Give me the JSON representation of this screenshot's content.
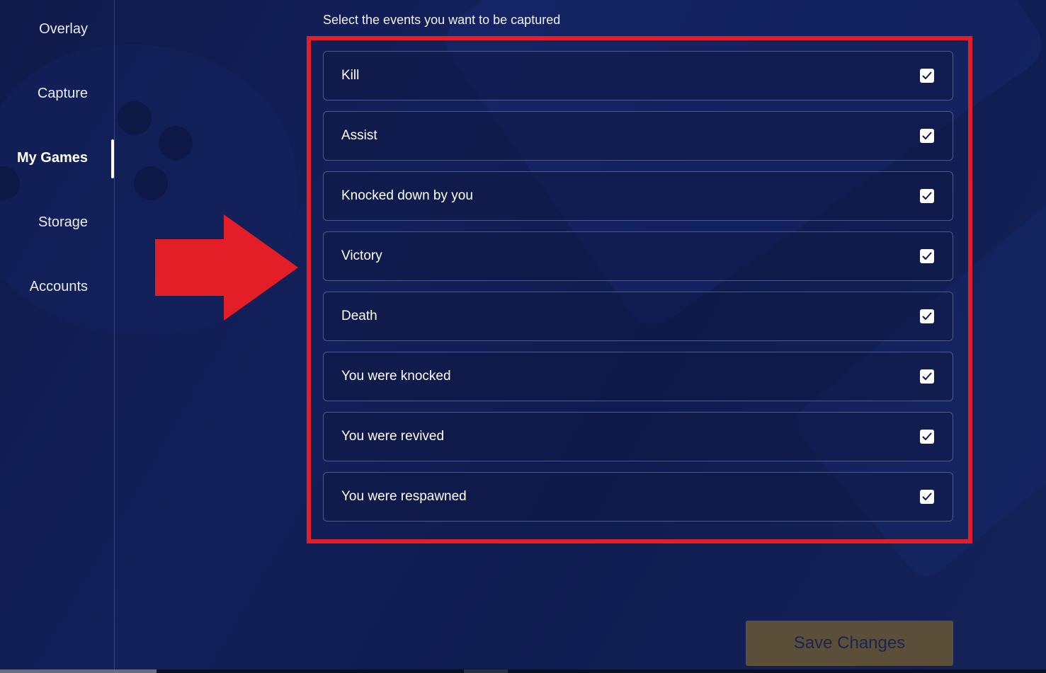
{
  "sidebar": {
    "items": [
      {
        "label": "Overlay",
        "active": false
      },
      {
        "label": "Capture",
        "active": false
      },
      {
        "label": "My Games",
        "active": true
      },
      {
        "label": "Storage",
        "active": false
      },
      {
        "label": "Accounts",
        "active": false
      }
    ]
  },
  "main": {
    "title": "Select the events you want to be captured",
    "events": [
      {
        "label": "Kill",
        "checked": true
      },
      {
        "label": "Assist",
        "checked": true
      },
      {
        "label": "Knocked down by you",
        "checked": true
      },
      {
        "label": "Victory",
        "checked": true
      },
      {
        "label": "Death",
        "checked": true
      },
      {
        "label": "You were knocked",
        "checked": true
      },
      {
        "label": "You were revived",
        "checked": true
      },
      {
        "label": "You were respawned",
        "checked": true
      }
    ],
    "save_label": "Save Changes"
  },
  "annotation": {
    "highlight_color": "#e41e26",
    "arrow_icon": "arrow-right-icon"
  },
  "colors": {
    "background": "#13205a",
    "save_button": "#5c4f3a"
  }
}
